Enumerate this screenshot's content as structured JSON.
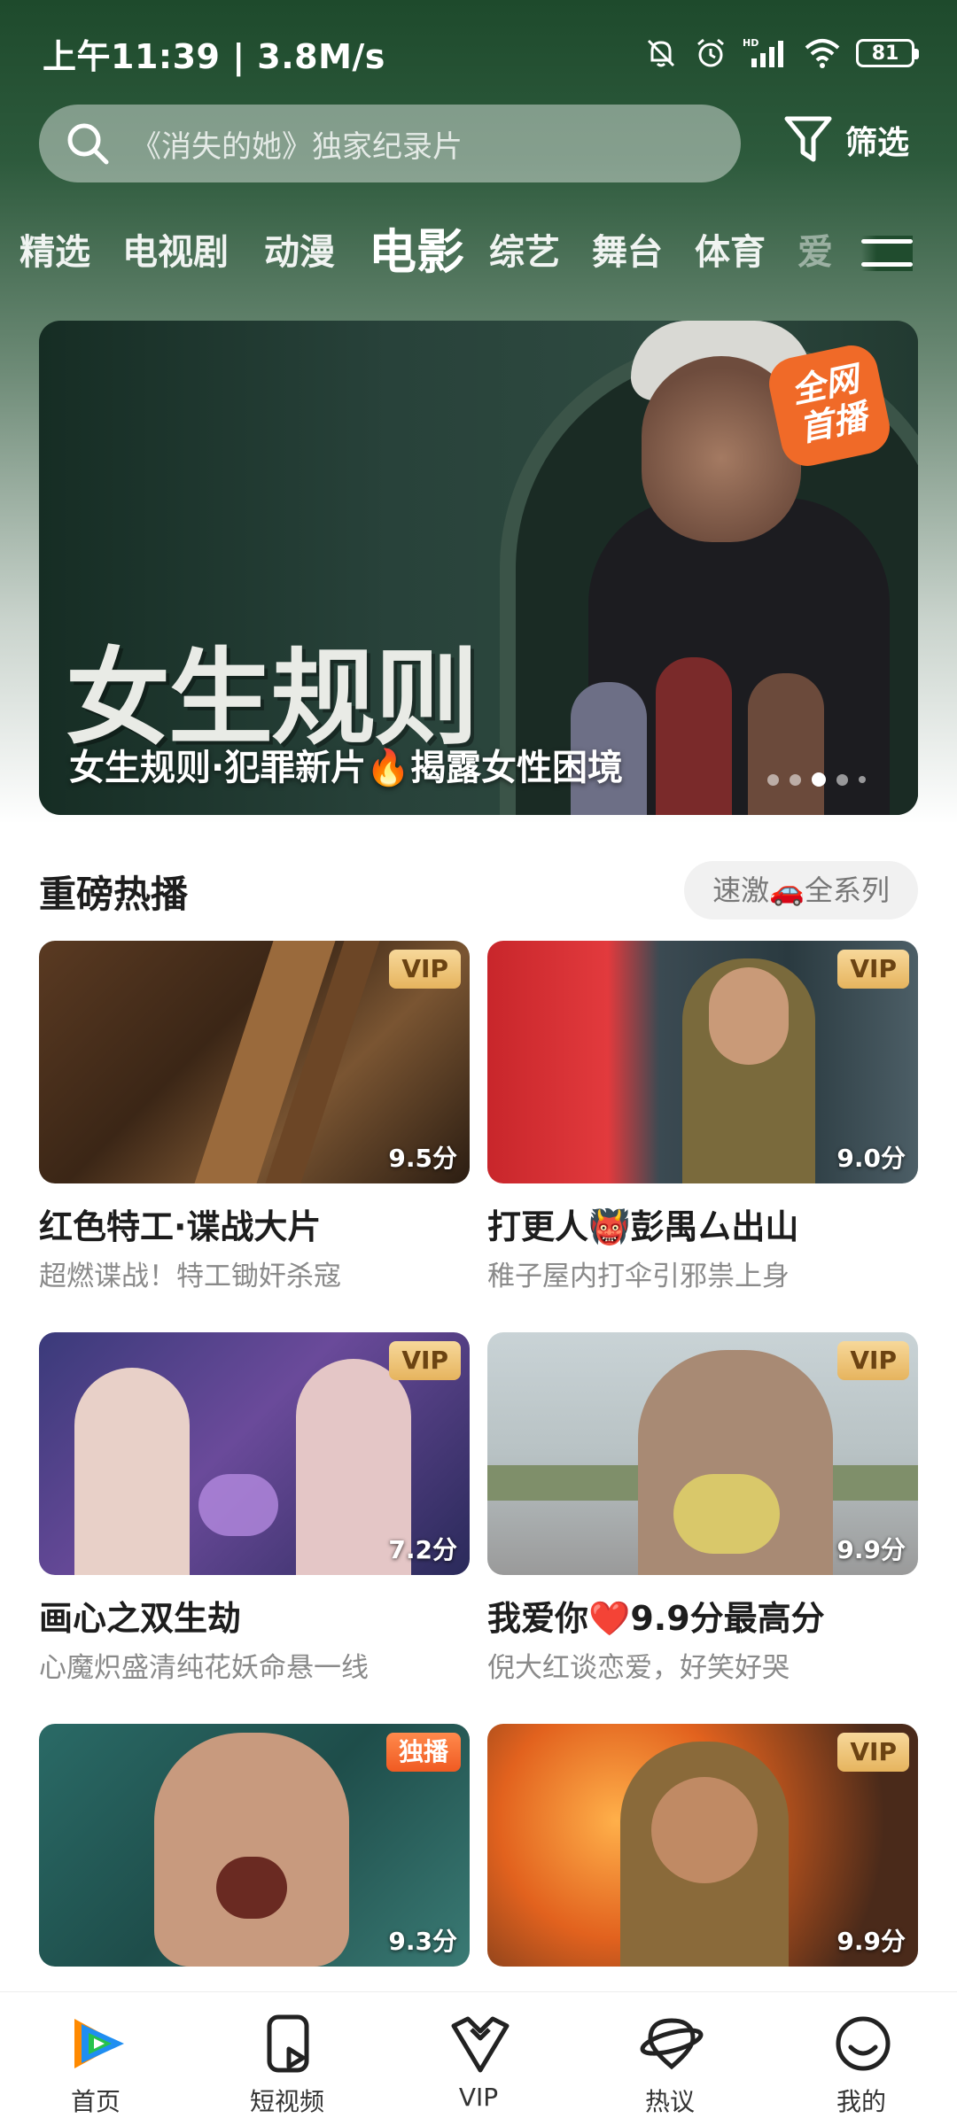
{
  "statusbar": {
    "time": "上午11:39 | 3.8M/s",
    "battery": "81",
    "icons": [
      "bell-off-icon",
      "alarm-icon",
      "hd-signal-icon",
      "wifi-icon",
      "battery-icon"
    ]
  },
  "search": {
    "placeholder": "《消失的她》独家纪录片",
    "filter_label": "筛选"
  },
  "tabs": [
    "精选",
    "电视剧",
    "动漫",
    "电影",
    "综艺",
    "舞台",
    "体育",
    "爱"
  ],
  "active_tab": "电影",
  "banner": {
    "title_art": "女生规则",
    "caption": "女生规则·犯罪新片🔥揭露女性困境",
    "badge_line1": "全网",
    "badge_line2": "首播",
    "slide_index": 3,
    "slide_count": 5
  },
  "section": {
    "title": "重磅热播",
    "chip": "速激🚗全系列"
  },
  "cards": [
    {
      "title": "红色特工·谍战大片",
      "subtitle": "超燃谍战！特工锄奸杀寇",
      "badge": "VIP",
      "score": "9.5分"
    },
    {
      "title": "打更人👹彭禺厶出山",
      "subtitle": "稚子屋内打伞引邪祟上身",
      "badge": "VIP",
      "score": "9.0分"
    },
    {
      "title": "画心之双生劫",
      "subtitle": "心魔炽盛清纯花妖命悬一线",
      "badge": "VIP",
      "score": "7.2分"
    },
    {
      "title": "我爱你❤️9.9分最高分",
      "subtitle": "倪大红谈恋爱，好笑好哭",
      "badge": "VIP",
      "score": "9.9分"
    },
    {
      "title": "",
      "subtitle": "",
      "badge": "独播",
      "score": "9.3分"
    },
    {
      "title": "",
      "subtitle": "",
      "badge": "VIP",
      "score": "9.9分"
    }
  ],
  "navbar": [
    "首页",
    "短视频",
    "VIP",
    "热议",
    "我的"
  ],
  "colors": {
    "header_green": "#1e4a2c",
    "vip_gold": "#e6b45e",
    "exclusive_orange": "#f05a22",
    "brand_blue": "#1f8ef1",
    "brand_green": "#27c24c",
    "brand_orange": "#ff8a00"
  }
}
